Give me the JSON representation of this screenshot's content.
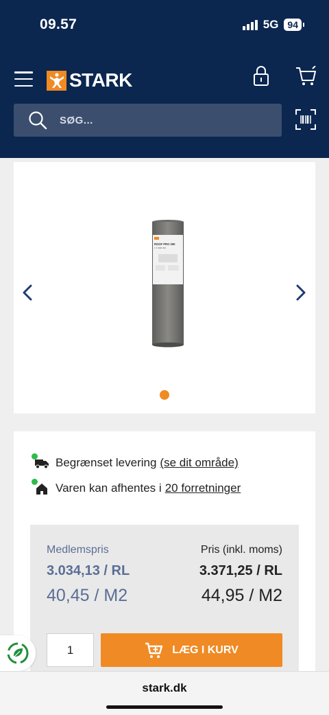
{
  "status_bar": {
    "time": "09.57",
    "network": "5G",
    "battery": "94"
  },
  "header": {
    "brand": "STARK"
  },
  "search": {
    "placeholder": "SØG..."
  },
  "gallery": {
    "product_label_line1": "ROOF PRO 290",
    "product_label_line2": "1 X 40M 290",
    "active_slide": 1,
    "slide_count": 1
  },
  "availability": {
    "delivery_text": "Begrænset levering",
    "delivery_link": "(se dit område)",
    "pickup_text": "Varen kan afhentes i",
    "pickup_link": "20 forretninger"
  },
  "pricing": {
    "member_label": "Medlemspris",
    "member_price": "3.034,13 / RL",
    "member_unit_price": "40,45 / M2",
    "regular_label": "Pris (inkl. moms)",
    "regular_price": "3.371,25 / RL",
    "regular_unit_price": "44,95 / M2"
  },
  "cart": {
    "quantity": "1",
    "add_label": "LÆG I KURV"
  },
  "browser": {
    "url": "stark.dk"
  },
  "colors": {
    "header_bg": "#0b2750",
    "accent": "#f08a24",
    "member_price": "#5a6e96",
    "availability_dot": "#2ebb4a"
  }
}
